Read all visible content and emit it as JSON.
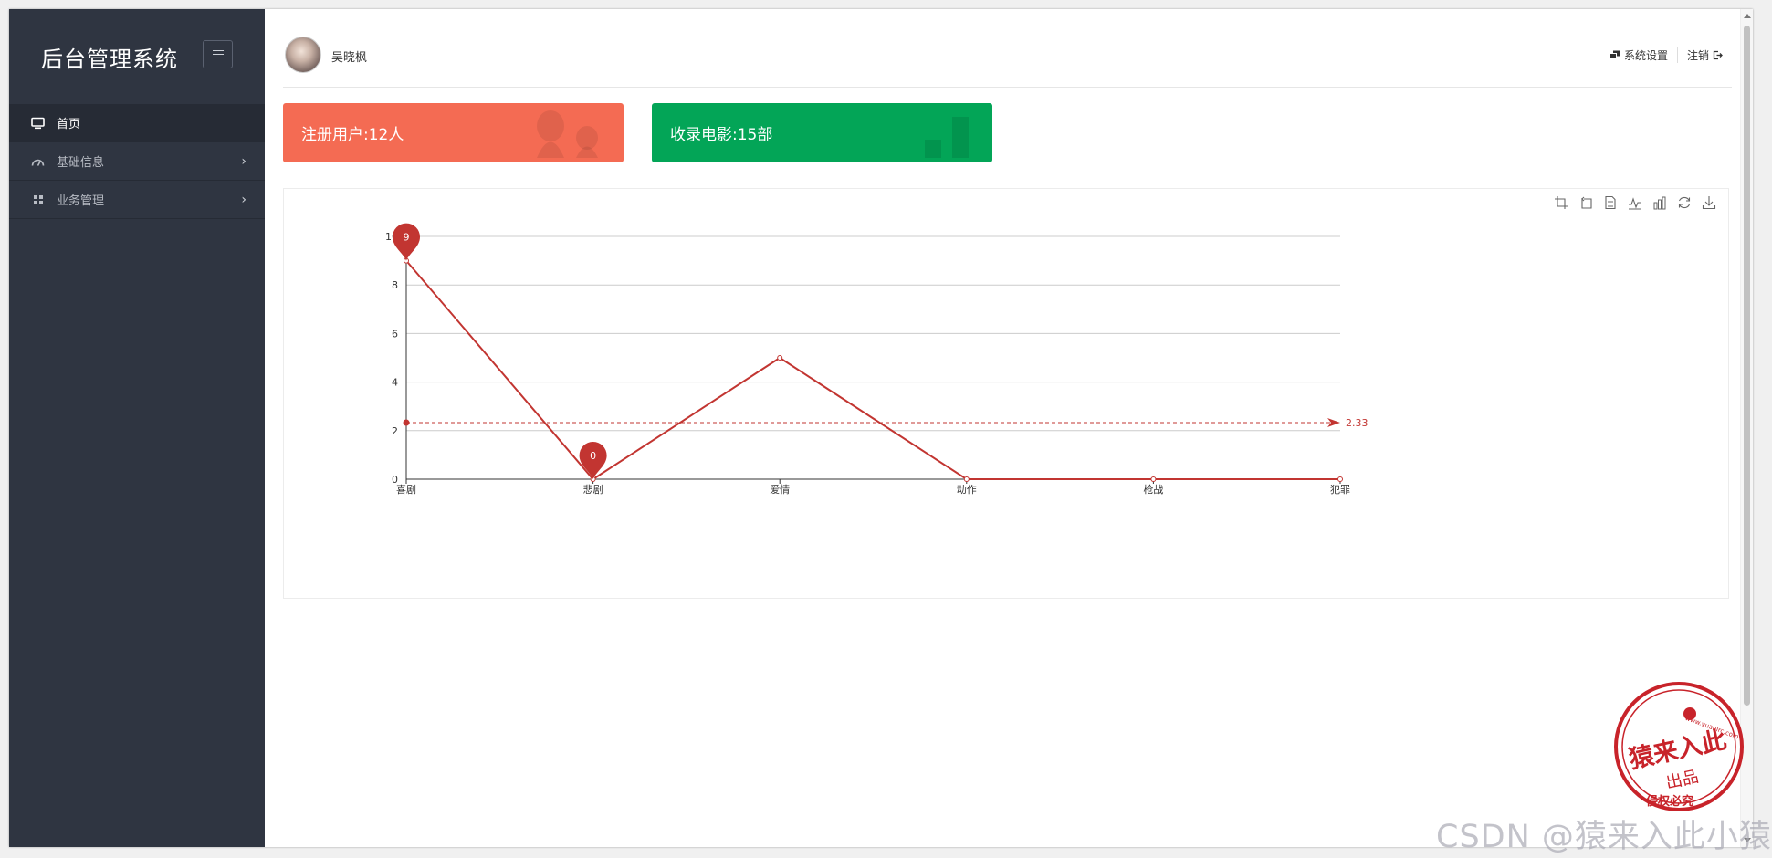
{
  "app": {
    "title": "后台管理系统"
  },
  "sidebar": {
    "items": [
      {
        "label": "首页",
        "icon": "monitor-icon",
        "active": true
      },
      {
        "label": "基础信息",
        "icon": "dashboard-icon",
        "has_children": true
      },
      {
        "label": "业务管理",
        "icon": "grid-icon",
        "has_children": true
      }
    ]
  },
  "header": {
    "username": "吴晓枫",
    "settings_label": "系统设置",
    "logout_label": "注销"
  },
  "cards": {
    "users_text": "注册用户:12人",
    "movies_text": "收录电影:15部",
    "users_color": "#f46b53",
    "movies_color": "#03a557"
  },
  "toolbox": [
    "crop-icon",
    "crop-undo-icon",
    "data-view-icon",
    "line-switch-icon",
    "bar-switch-icon",
    "restore-icon",
    "download-icon"
  ],
  "chart_data": {
    "type": "line",
    "categories": [
      "喜剧",
      "悲剧",
      "爱情",
      "动作",
      "枪战",
      "犯罪"
    ],
    "series": [
      {
        "values": [
          9,
          0,
          5,
          0,
          0,
          0
        ],
        "color": "#c23531"
      }
    ],
    "ylim": [
      0,
      10
    ],
    "yticks": [
      "0",
      "2",
      "4",
      "6",
      "8",
      "10"
    ],
    "mark_points": [
      {
        "category": "喜剧",
        "value": "9"
      },
      {
        "category": "悲剧",
        "value": "0"
      }
    ],
    "mark_line": {
      "value": 2.33,
      "label": "2.33"
    },
    "grid": true,
    "legend": "none"
  },
  "watermark": {
    "text": "CSDN @猿来入此小猿"
  },
  "stamp": {
    "main": "猿来入此",
    "sub": "出品",
    "url": "www.yuanlrc.com",
    "bottom": "侵权必究"
  }
}
